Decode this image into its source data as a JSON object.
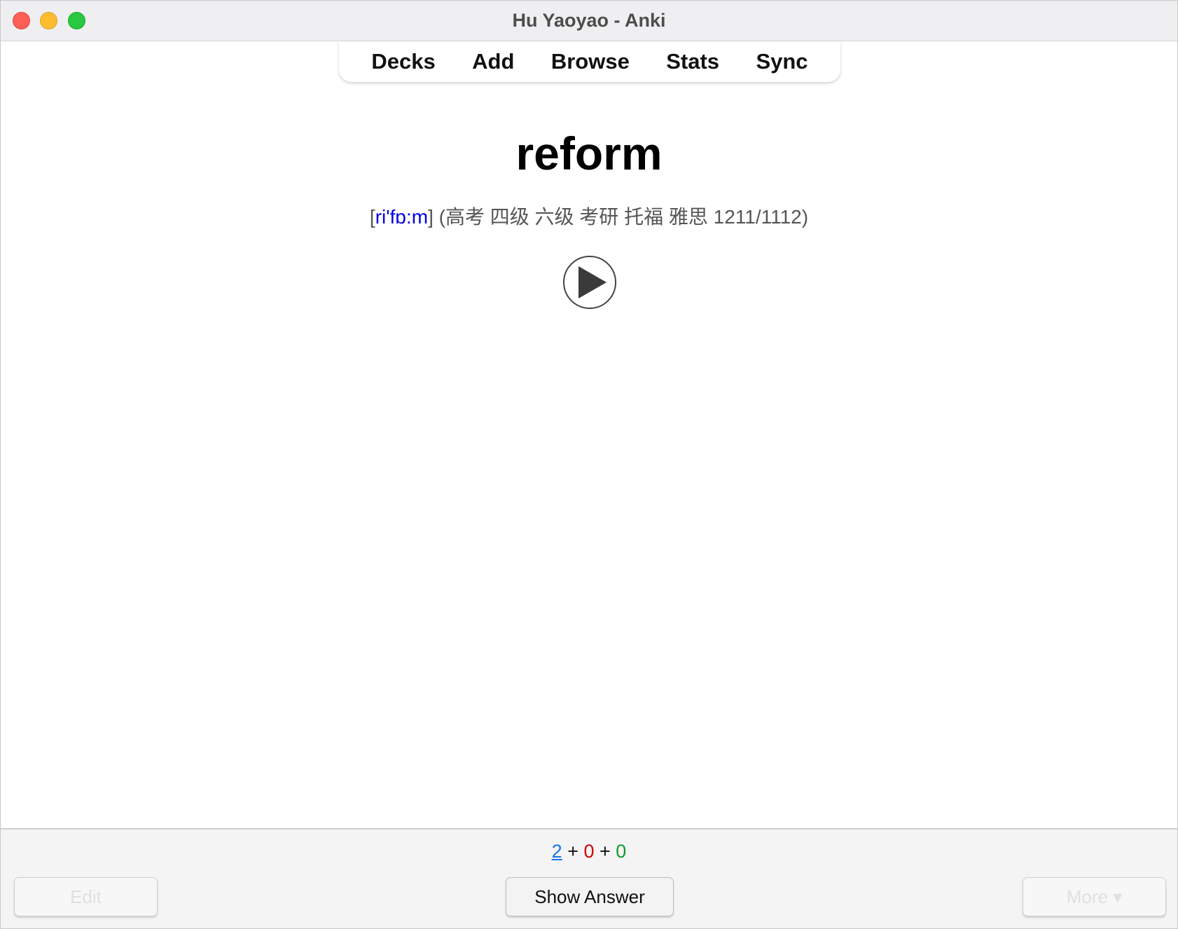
{
  "window": {
    "title": "Hu Yaoyao - Anki"
  },
  "nav": {
    "items": [
      "Decks",
      "Add",
      "Browse",
      "Stats",
      "Sync"
    ]
  },
  "card": {
    "word": "reform",
    "phonetic_open": "[",
    "phonetic": "ri'fɒ:m",
    "phonetic_close": "]",
    "tags": " (高考 四级 六级 考研 托福 雅思 1211/1112)"
  },
  "counts": {
    "new": "2",
    "learning": "0",
    "review": "0",
    "separator": " + "
  },
  "buttons": {
    "edit": "Edit",
    "show_answer": "Show Answer",
    "more": "More ▾"
  },
  "colors": {
    "phonetic": "#0000e6",
    "new_count": "#1a73e8",
    "learning_count": "#d40000",
    "review_count": "#119a2c"
  }
}
